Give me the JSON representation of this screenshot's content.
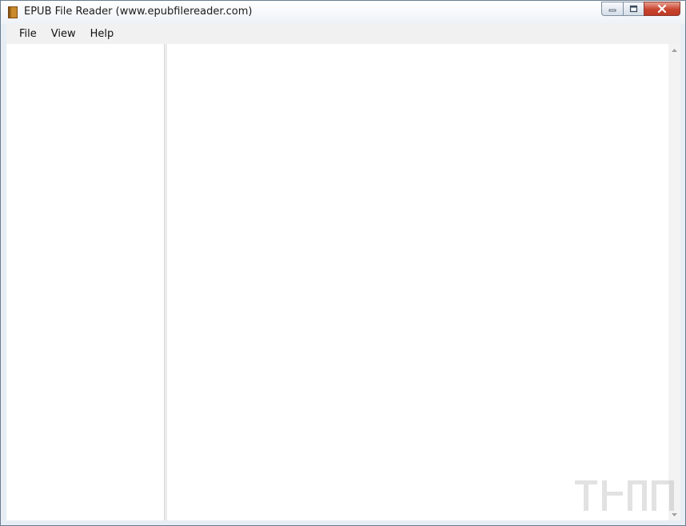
{
  "window": {
    "title": "EPUB File Reader (www.epubfilereader.com)",
    "icon": "book-icon"
  },
  "caption_buttons": [
    {
      "name": "minimize",
      "icon": "minimize-icon"
    },
    {
      "name": "maximize",
      "icon": "restore-icon"
    },
    {
      "name": "close",
      "icon": "close-icon"
    }
  ],
  "menu": {
    "items": [
      {
        "label": "File"
      },
      {
        "label": "View"
      },
      {
        "label": "Help"
      }
    ]
  },
  "colors": {
    "close_button": "#c8442f",
    "menubar": "#f1f1f1",
    "splitter": "#ebebeb"
  }
}
